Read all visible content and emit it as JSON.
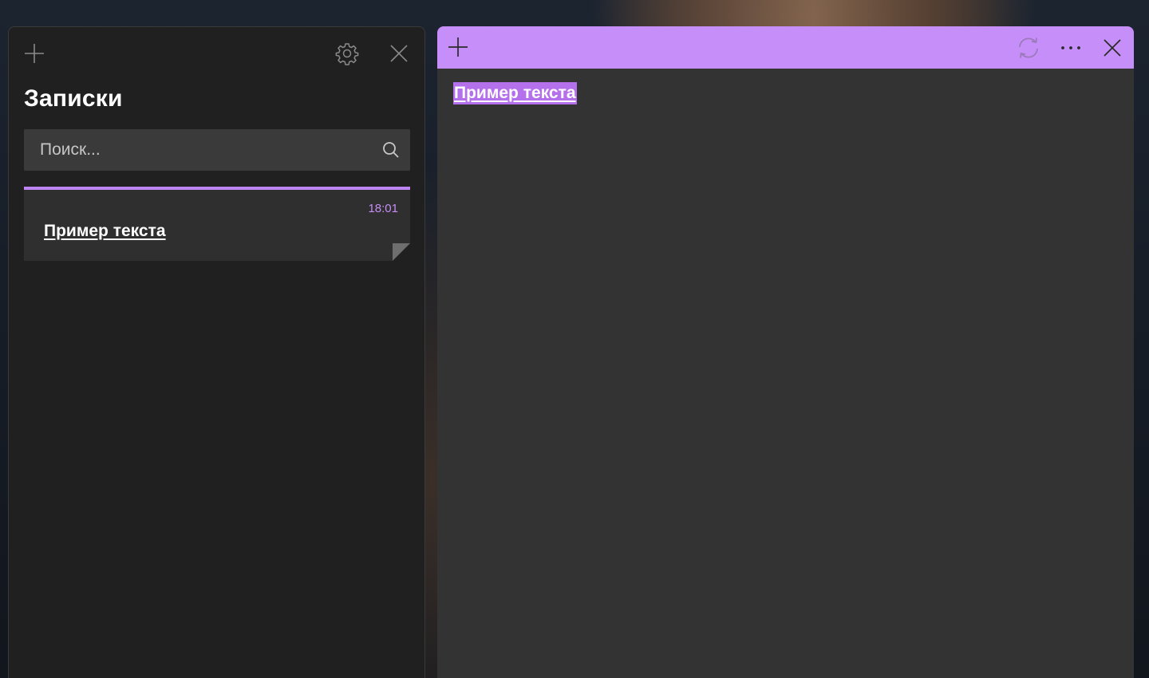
{
  "colors": {
    "accent": "#c68ef8",
    "list_bg": "#202020",
    "note_bg": "#333333",
    "search_bg": "#3a3a3a",
    "card_bg": "#2f2f2f",
    "time_color": "#c58df5",
    "selection": "#b570ec"
  },
  "list_window": {
    "title": "Записки",
    "icons": {
      "add": "plus-icon",
      "settings": "gear-icon",
      "close": "close-icon"
    },
    "search": {
      "placeholder": "Поиск...",
      "value": "",
      "icon": "search-icon"
    },
    "notes": [
      {
        "time": "18:01",
        "preview": "Пример текста",
        "color": "#bd85f2"
      }
    ]
  },
  "note_window": {
    "icons": {
      "add": "plus-icon",
      "sync": "sync-icon",
      "more": "more-icon",
      "close": "close-icon"
    },
    "content": "Пример текста",
    "content_selected": true
  }
}
